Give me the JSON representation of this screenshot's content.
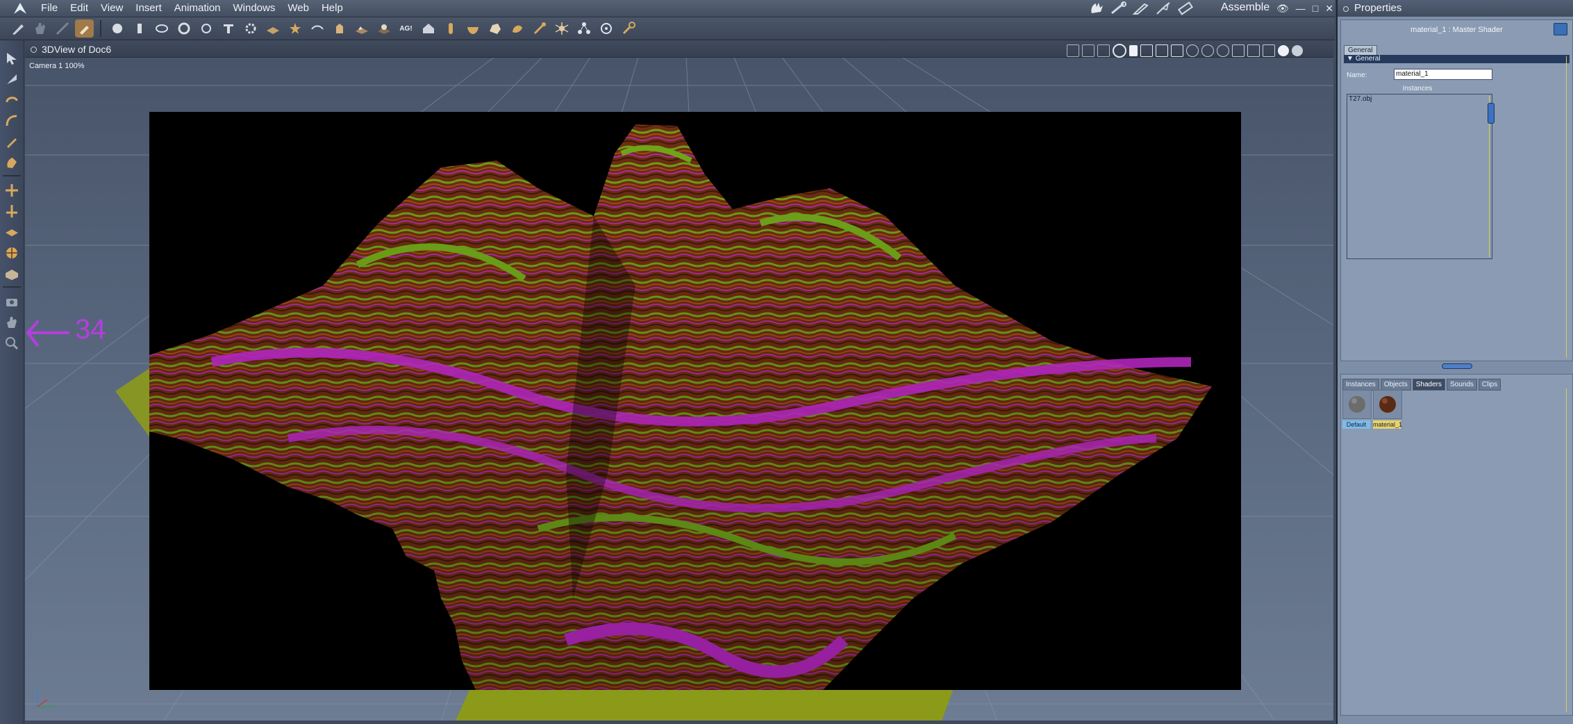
{
  "menubar": {
    "items": [
      "File",
      "Edit",
      "View",
      "Insert",
      "Animation",
      "Windows",
      "Web",
      "Help"
    ],
    "room": "Assemble",
    "window_controls": [
      "👁",
      "—",
      "□",
      "✕"
    ]
  },
  "toolbar": {
    "icons": [
      "paint-brush-icon",
      "hand-icon",
      "stretch-icon",
      "hammer-icon",
      "sphere-icon",
      "cylinder-icon",
      "bezier-tool-icon",
      "torus-icon",
      "ring-icon",
      "text-3d-icon",
      "gear-icon",
      "plane-icon",
      "star-icon",
      "lathe-icon",
      "extrude-icon",
      "terrain-icon",
      "tree-icon",
      "ag-label-icon",
      "house-icon",
      "column-icon",
      "bowl-icon",
      "rock-icon",
      "stamp-icon",
      "dig-icon",
      "spider-icon",
      "network-icon",
      "target-icon",
      "wrench-icon"
    ]
  },
  "leftstrip": {
    "icons": [
      "select-arrow-icon",
      "rotate-arrow-icon",
      "twist-icon",
      "bend-icon",
      "pen-icon",
      "grab-hand-icon",
      "move-xyz-icon",
      "move-axis-icon",
      "move-plane-icon",
      "trackball-icon",
      "ground-icon",
      "camera-icon",
      "pan-hand-icon",
      "zoom-icon"
    ]
  },
  "viewport": {
    "title": "3DView of Doc6",
    "camera_label": "Camera 1 100%",
    "annotation_number": "34"
  },
  "properties": {
    "title": "Properties",
    "shader_heading": "material_1 : Master Shader",
    "tab": "General",
    "section": "General",
    "name_label": "Name:",
    "name_value": "material_1",
    "instances_label": "Instances",
    "instances": [
      "T27.obj"
    ]
  },
  "library": {
    "tabs": [
      "Instances",
      "Objects",
      "Shaders",
      "Sounds",
      "Clips"
    ],
    "active_tab": "Shaders",
    "shaders": [
      {
        "label": "Default",
        "label_bg": "#7fbbe8",
        "ball": "#6c6c6c"
      },
      {
        "label": "material_1",
        "label_bg": "#e8d36a",
        "ball": "#5a2a14"
      }
    ]
  },
  "colors": {
    "accent": "#b53ee0",
    "selection_yellow": "#d8cf5a",
    "terrain_green": "#6f9b1c",
    "terrain_magenta": "#c42ad0",
    "terrain_brown": "#7a3a12"
  }
}
